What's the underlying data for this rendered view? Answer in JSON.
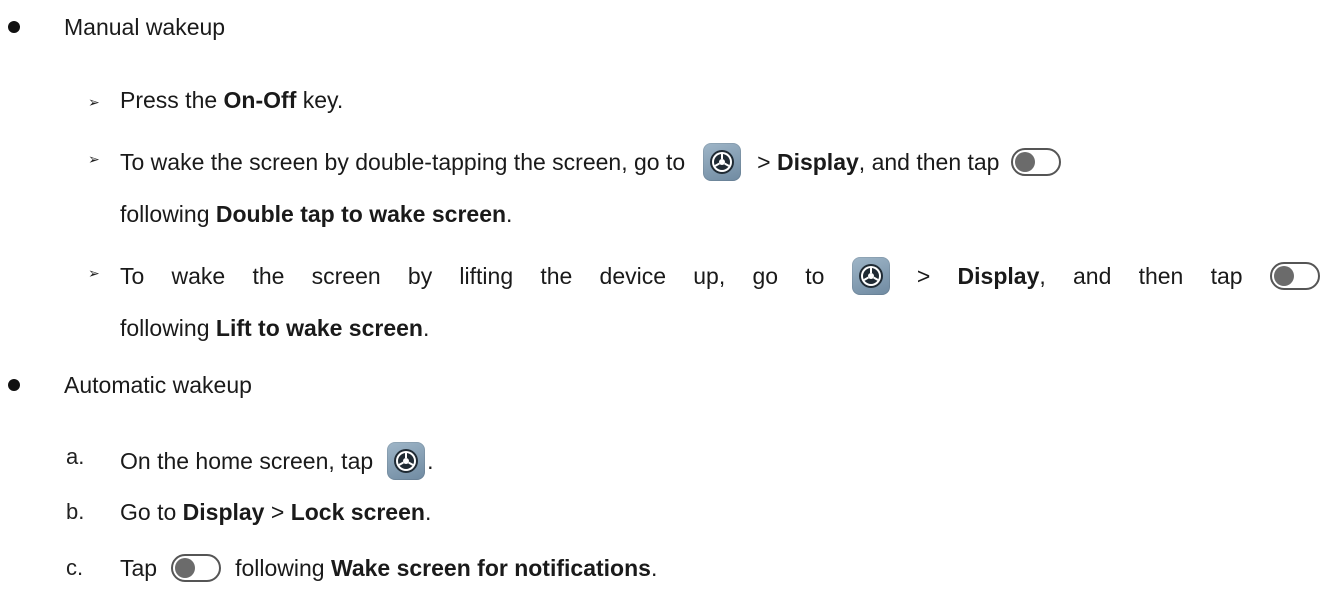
{
  "manual": {
    "title": "Manual wakeup",
    "item1": {
      "pre": "Press the ",
      "key": "On-Off",
      "post": " key."
    },
    "item2": {
      "pre": "To wake the screen by double-tapping the screen, go to",
      "mid": "> ",
      "menu": "Display",
      "after": ", and then tap",
      "line2_pre": "following ",
      "setting": "Double tap to wake screen",
      "line2_post": "."
    },
    "item3": {
      "w1": "To",
      "w2": "wake",
      "w3": "the",
      "w4": "screen",
      "w5": "by",
      "w6": "lifting",
      "w7": "the",
      "w8": "device",
      "w9": "up,",
      "w10": "go",
      "w11": "to",
      "mid": ">",
      "menu": "Display",
      "after_a": ",",
      "after_b": "and",
      "after_c": "then",
      "after_d": "tap",
      "line2_pre": "following ",
      "setting": "Lift to wake screen",
      "line2_post": "."
    }
  },
  "automatic": {
    "title": "Automatic wakeup",
    "step_a": {
      "label": "a.",
      "pre": "On the home screen, tap",
      "post": "."
    },
    "step_b": {
      "label": "b.",
      "pre": "Go to ",
      "menu1": "Display",
      "sep": " > ",
      "menu2": "Lock screen",
      "post": "."
    },
    "step_c": {
      "label": "c.",
      "pre": "Tap",
      "mid": "following ",
      "setting": "Wake screen for notifications",
      "post": "."
    }
  },
  "icons": {
    "settings": "settings-gear-icon",
    "toggle": "toggle-off-icon"
  },
  "colors": {
    "text": "#1a1a1a",
    "gear_bg": "#7f98ad",
    "toggle_knob": "#6b6b6b"
  }
}
